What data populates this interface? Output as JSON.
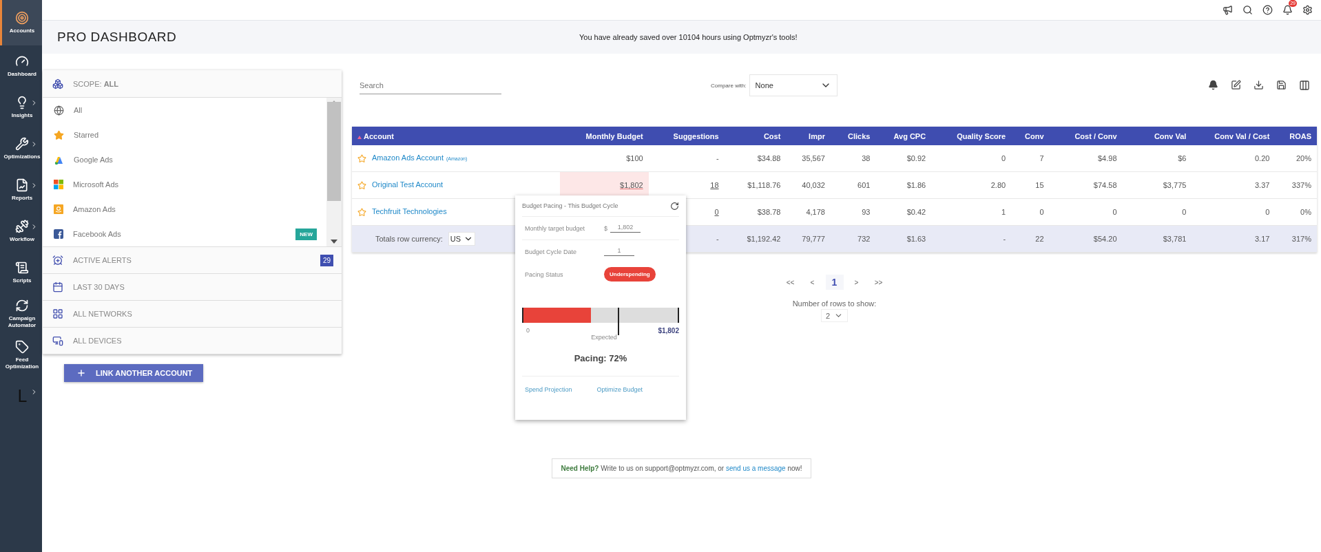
{
  "sidebar": {
    "items": [
      {
        "kind": "accounts",
        "label": "Accounts",
        "selected": true,
        "has_submenu": false
      },
      {
        "kind": "dashboard",
        "label": "Dashboard",
        "selected": false,
        "has_submenu": false
      },
      {
        "kind": "insights",
        "label": "Insights",
        "selected": false,
        "has_submenu": true
      },
      {
        "kind": "optimizations",
        "label": "Optimizations",
        "selected": false,
        "has_submenu": true
      },
      {
        "kind": "reports",
        "label": "Reports",
        "selected": false,
        "has_submenu": true
      },
      {
        "kind": "workflow",
        "label": "Workflow",
        "selected": false,
        "has_submenu": true
      },
      {
        "kind": "scripts",
        "label": "Scripts",
        "selected": false,
        "has_submenu": false
      },
      {
        "kind": "automator",
        "label": "Campaign Automator",
        "selected": false,
        "has_submenu": false
      },
      {
        "kind": "feed",
        "label": "Feed Optimization",
        "selected": false,
        "has_submenu": false
      },
      {
        "kind": "user",
        "label": "L",
        "selected": false,
        "has_submenu": true
      }
    ]
  },
  "topbar": {
    "notification_count": "29"
  },
  "header": {
    "title": "PRO DASHBOARD",
    "message": "You have already saved over 10104 hours using Optmyzr's tools!"
  },
  "scope_panel": {
    "scope": "SCOPE: **ALL**",
    "networks": [
      {
        "kind": "all",
        "label": "All"
      },
      {
        "kind": "starred",
        "label": "Starred"
      },
      {
        "kind": "google",
        "label": "Google Ads"
      },
      {
        "kind": "microsoft",
        "label": "Microsoft Ads"
      },
      {
        "kind": "amazon",
        "label": "Amazon Ads"
      },
      {
        "kind": "facebook",
        "label": "Facebook Ads",
        "badge": "NEW"
      }
    ],
    "filters": [
      {
        "kind": "alerts",
        "label": "ACTIVE ALERTS",
        "count": "29"
      },
      {
        "kind": "date",
        "label": "LAST 30 DAYS"
      },
      {
        "kind": "networks",
        "label": "ALL NETWORKS"
      },
      {
        "kind": "devices",
        "label": "ALL DEVICES"
      }
    ],
    "link_button": "LINK ANOTHER ACCOUNT"
  },
  "toolbar": {
    "search_placeholder": "Search",
    "compare_label": "Compare with:",
    "compare_value": "None"
  },
  "table": {
    "columns": [
      {
        "label": "Account",
        "sorted": true
      },
      {
        "label": "Monthly Budget",
        "sorted": false
      },
      {
        "label": "Suggestions",
        "sorted": false
      },
      {
        "label": "Cost",
        "sorted": false
      },
      {
        "label": "Impr",
        "sorted": false
      },
      {
        "label": "Clicks",
        "sorted": false
      },
      {
        "label": "Avg CPC",
        "sorted": false
      },
      {
        "label": "Quality Score",
        "sorted": false
      },
      {
        "label": "Conv",
        "sorted": false
      },
      {
        "label": "Cost / Conv",
        "sorted": false
      },
      {
        "label": "Conv Val",
        "sorted": false
      },
      {
        "label": "Conv Val / Cost",
        "sorted": false
      },
      {
        "label": "ROAS",
        "sorted": false
      }
    ],
    "rows": [
      {
        "account": "Amazon Ads Account",
        "network_tag": "(Amazon)",
        "starred": false,
        "budget_highlighted": false,
        "suggestions_link": false,
        "budget": "$100",
        "values": [
          "-",
          "$34.88",
          "35,567",
          "38",
          "$0.92",
          "0",
          "7",
          "$4.98",
          "$6",
          "0.20",
          "20%"
        ]
      },
      {
        "account": "Original Test Account",
        "starred": false,
        "budget_highlighted": true,
        "suggestions_link": true,
        "budget": "$1,802",
        "values": [
          "18",
          "$1,118.76",
          "40,032",
          "601",
          "$1.86",
          "2.80",
          "15",
          "$74.58",
          "$3,775",
          "3.37",
          "337%"
        ]
      },
      {
        "account": "Techfruit Technologies",
        "starred": false,
        "budget_highlighted": false,
        "suggestions_link": true,
        "values": [
          "0",
          "$38.78",
          "4,178",
          "93",
          "$0.42",
          "1",
          "0",
          "0",
          "0",
          "0",
          "0%"
        ]
      }
    ],
    "totals": {
      "label": "Totals row currency:",
      "currency": "US",
      "values": [
        "-",
        "$1,192.42",
        "79,777",
        "732",
        "$1.63",
        "-",
        "22",
        "$54.20",
        "$3,781",
        "3.17",
        "317%"
      ]
    }
  },
  "budget_popup": {
    "title": "Budget Pacing - This Budget Cycle",
    "fields": [
      {
        "label": "Monthly target budget",
        "prefix": "$",
        "value": "1,802"
      },
      {
        "label": "Budget Cycle Date",
        "value": "1"
      }
    ],
    "status": {
      "label": "Pacing Status",
      "kind": "under",
      "value": "Underspending"
    },
    "bar": {
      "level": 0.44,
      "start": "0",
      "expected": "Expected",
      "end": "$1,802"
    },
    "pacing": "Pacing: 72%",
    "links": [
      "Spend Projection",
      "Optimize Budget"
    ]
  },
  "pagination": {
    "pages": [
      {
        "label": "<<",
        "selected": false
      },
      {
        "label": "<",
        "selected": false
      },
      {
        "label": "1",
        "selected": true
      },
      {
        "label": ">",
        "selected": false
      },
      {
        "label": ">>",
        "selected": false
      }
    ],
    "rows_label": "Number of rows to show:",
    "rows_value": "2"
  },
  "help": {
    "lead": "Need Help?",
    "text": "Write to us on support@optmyzr.com, or",
    "link": "send us a message",
    "tail": "now!"
  }
}
